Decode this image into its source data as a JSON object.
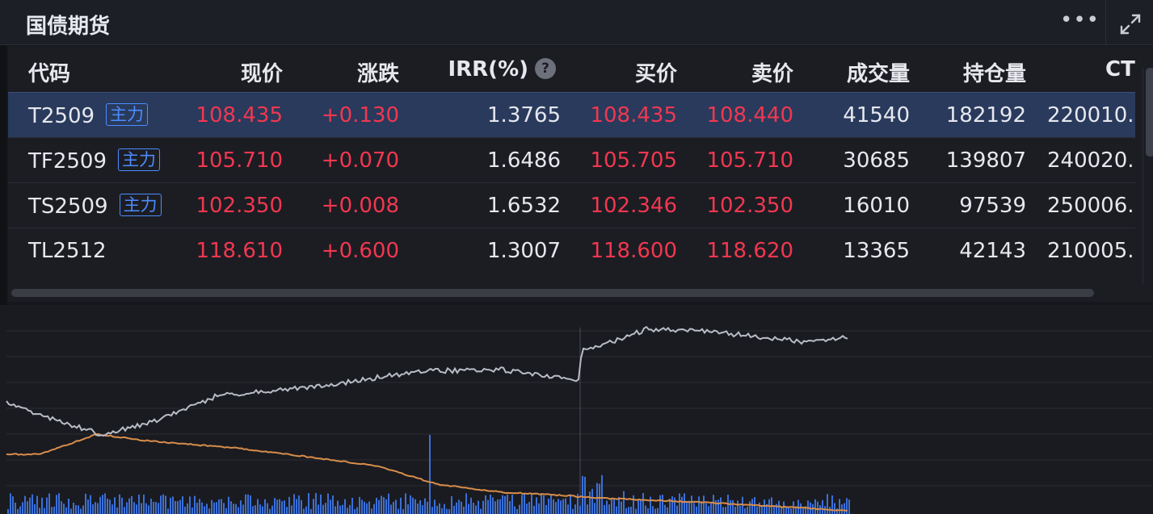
{
  "panel": {
    "title": "国债期货",
    "more_glyph": "•••"
  },
  "colors": {
    "up": "#f23750",
    "accent": "#4d8cff",
    "selected_row": "#293a5c",
    "price_line": "#b8bcc6",
    "avg_line": "#d88d4b",
    "volume_bar": "#3b6fd8"
  },
  "icons": {
    "more": "more-horizontal-icon",
    "expand": "expand-icon",
    "help": "question-circle-icon"
  },
  "table": {
    "headers": [
      "代码",
      "现价",
      "涨跌",
      "IRR(%)",
      "买价",
      "卖价",
      "成交量",
      "持仓量",
      "CT"
    ],
    "help_glyph": "?",
    "rows": [
      {
        "code": "T2509",
        "tag": "主力",
        "price": "108.435",
        "change": "+0.130",
        "irr": "1.3765",
        "bid": "108.435",
        "ask": "108.440",
        "volume": "41540",
        "open_interest": "182192",
        "ct": "220010."
      },
      {
        "code": "TF2509",
        "tag": "主力",
        "price": "105.710",
        "change": "+0.070",
        "irr": "1.6486",
        "bid": "105.705",
        "ask": "105.710",
        "volume": "30685",
        "open_interest": "139807",
        "ct": "240020."
      },
      {
        "code": "TS2509",
        "tag": "主力",
        "price": "102.350",
        "change": "+0.008",
        "irr": "1.6532",
        "bid": "102.346",
        "ask": "102.350",
        "volume": "16010",
        "open_interest": "97539",
        "ct": "250006."
      },
      {
        "code": "TL2512",
        "tag": "",
        "price": "118.610",
        "change": "+0.600",
        "irr": "1.3007",
        "bid": "118.600",
        "ask": "118.620",
        "volume": "13365",
        "open_interest": "42143",
        "ct": "210005."
      }
    ]
  }
}
